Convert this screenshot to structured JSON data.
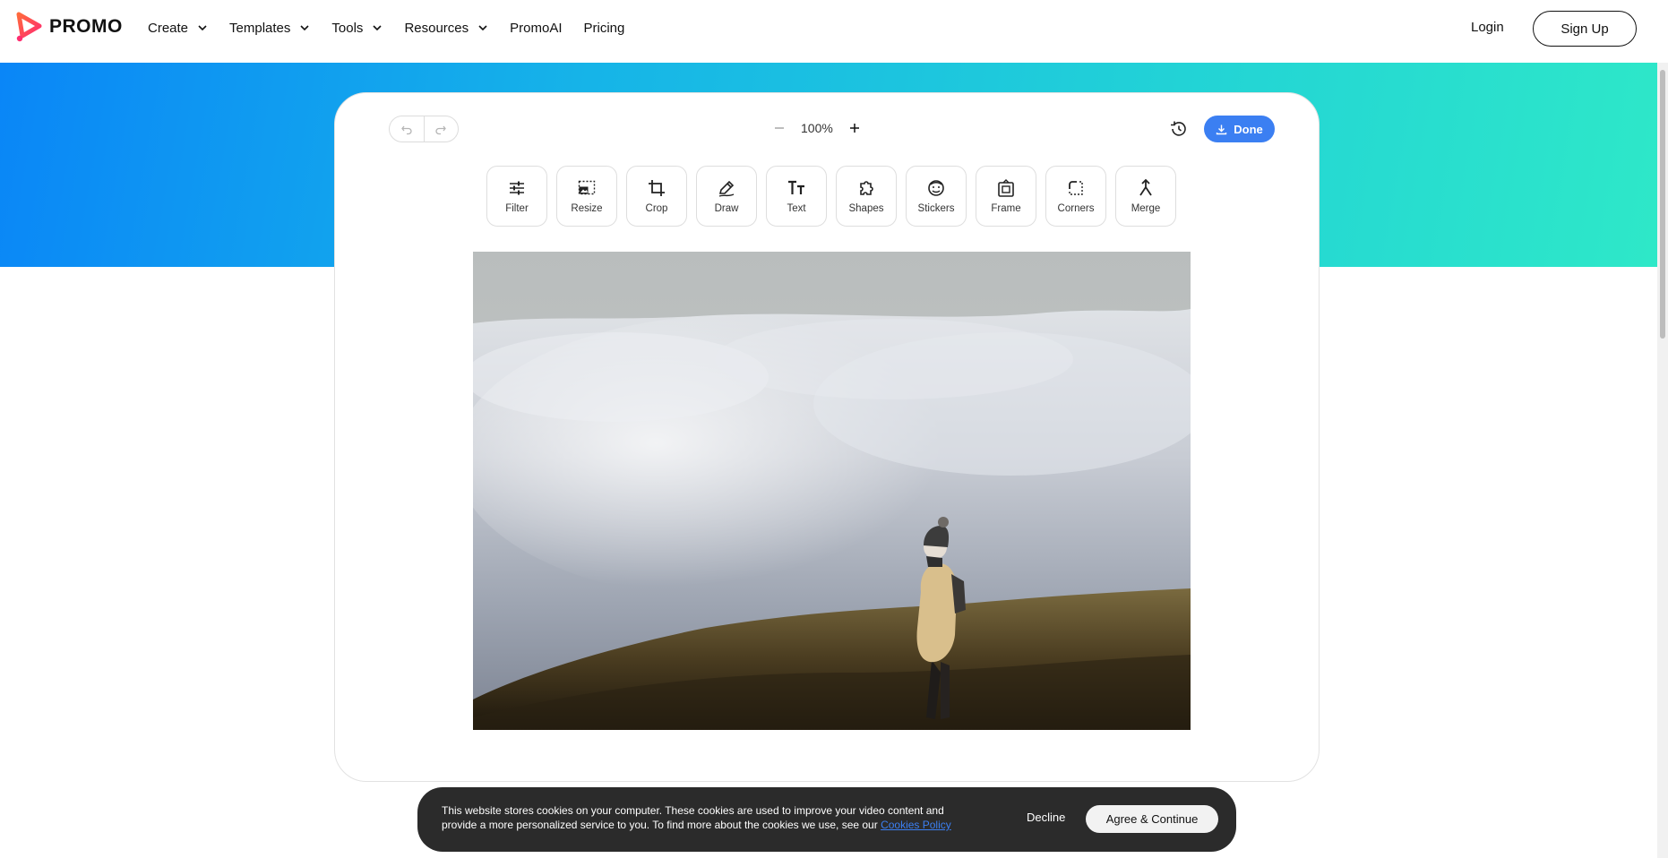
{
  "header": {
    "logo_text": "PROMO",
    "nav": [
      {
        "label": "Create",
        "has_dropdown": true
      },
      {
        "label": "Templates",
        "has_dropdown": true
      },
      {
        "label": "Tools",
        "has_dropdown": true
      },
      {
        "label": "Resources",
        "has_dropdown": true
      },
      {
        "label": "PromoAI",
        "has_dropdown": false
      },
      {
        "label": "Pricing",
        "has_dropdown": false
      }
    ],
    "login_label": "Login",
    "signup_label": "Sign Up"
  },
  "editor": {
    "zoom_level": "100%",
    "done_label": "Done",
    "tools": [
      {
        "label": "Filter",
        "icon": "sliders-icon"
      },
      {
        "label": "Resize",
        "icon": "resize-icon"
      },
      {
        "label": "Crop",
        "icon": "crop-icon"
      },
      {
        "label": "Draw",
        "icon": "draw-icon"
      },
      {
        "label": "Text",
        "icon": "text-icon"
      },
      {
        "label": "Shapes",
        "icon": "shapes-icon"
      },
      {
        "label": "Stickers",
        "icon": "sticker-icon"
      },
      {
        "label": "Frame",
        "icon": "frame-icon"
      },
      {
        "label": "Corners",
        "icon": "corners-icon"
      },
      {
        "label": "Merge",
        "icon": "merge-icon"
      }
    ],
    "image_subject": "hiker-above-clouds"
  },
  "cookie_banner": {
    "text": "This website stores cookies on your computer. These cookies are used to improve your video content and provide a more personalized service to you. To find more about the cookies we use, see our",
    "link_label": "Cookies Policy",
    "decline_label": "Decline",
    "agree_label": "Agree & Continue"
  },
  "colors": {
    "brand_pink": "#ff2d6f",
    "accent_blue": "#3b7ff2",
    "gradient_start": "#0a86f7",
    "gradient_end": "#2ee8c8"
  }
}
